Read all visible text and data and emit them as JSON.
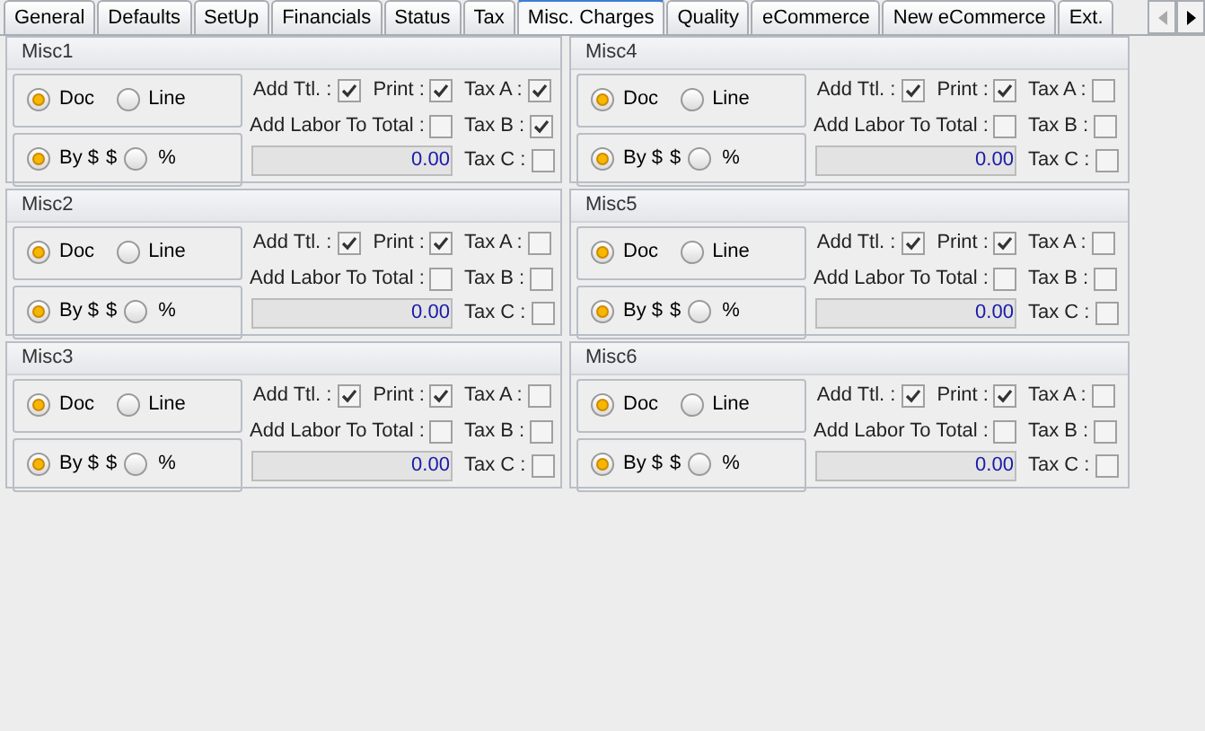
{
  "tabs": [
    {
      "label": "General",
      "selected": false
    },
    {
      "label": "Defaults",
      "selected": false
    },
    {
      "label": "SetUp",
      "selected": false
    },
    {
      "label": "Financials",
      "selected": false
    },
    {
      "label": "Status",
      "selected": false
    },
    {
      "label": "Tax",
      "selected": false
    },
    {
      "label": "Misc. Charges",
      "selected": true
    },
    {
      "label": "Quality",
      "selected": false
    },
    {
      "label": "eCommerce",
      "selected": false
    },
    {
      "label": "New eCommerce",
      "selected": false
    },
    {
      "label": "Ext.",
      "selected": false
    }
  ],
  "panels": [
    {
      "title": "Misc1",
      "scope": [
        {
          "label": "Doc",
          "selected": true
        },
        {
          "label": "Line",
          "selected": false
        }
      ],
      "by_label": "By $",
      "by_selected": true,
      "currency": "$",
      "pct_label": "%",
      "pct_selected": false,
      "add_ttl": {
        "label": "Add Ttl. :",
        "checked": true
      },
      "print": {
        "label": "Print :",
        "checked": true
      },
      "add_labor": {
        "label": "Add Labor To Total :",
        "checked": false
      },
      "amount": "0.00",
      "taxes": [
        {
          "label": "Tax A :",
          "checked": true
        },
        {
          "label": "Tax B :",
          "checked": true
        },
        {
          "label": "Tax C :",
          "checked": false
        }
      ]
    },
    {
      "title": "Misc4",
      "scope": [
        {
          "label": "Doc",
          "selected": true
        },
        {
          "label": "Line",
          "selected": false
        }
      ],
      "by_label": "By $",
      "by_selected": true,
      "currency": "$",
      "pct_label": "%",
      "pct_selected": false,
      "add_ttl": {
        "label": "Add Ttl. :",
        "checked": true
      },
      "print": {
        "label": "Print :",
        "checked": true
      },
      "add_labor": {
        "label": "Add Labor To Total :",
        "checked": false
      },
      "amount": "0.00",
      "taxes": [
        {
          "label": "Tax A :",
          "checked": false
        },
        {
          "label": "Tax B :",
          "checked": false
        },
        {
          "label": "Tax C :",
          "checked": false
        }
      ]
    },
    {
      "title": "Misc2",
      "scope": [
        {
          "label": "Doc",
          "selected": true
        },
        {
          "label": "Line",
          "selected": false
        }
      ],
      "by_label": "By $",
      "by_selected": true,
      "currency": "$",
      "pct_label": "%",
      "pct_selected": false,
      "add_ttl": {
        "label": "Add Ttl. :",
        "checked": true
      },
      "print": {
        "label": "Print :",
        "checked": true
      },
      "add_labor": {
        "label": "Add Labor To Total :",
        "checked": false
      },
      "amount": "0.00",
      "taxes": [
        {
          "label": "Tax A :",
          "checked": false
        },
        {
          "label": "Tax B :",
          "checked": false
        },
        {
          "label": "Tax C :",
          "checked": false
        }
      ]
    },
    {
      "title": "Misc5",
      "scope": [
        {
          "label": "Doc",
          "selected": true
        },
        {
          "label": "Line",
          "selected": false
        }
      ],
      "by_label": "By $",
      "by_selected": true,
      "currency": "$",
      "pct_label": "%",
      "pct_selected": false,
      "add_ttl": {
        "label": "Add Ttl. :",
        "checked": true
      },
      "print": {
        "label": "Print :",
        "checked": true
      },
      "add_labor": {
        "label": "Add Labor To Total :",
        "checked": false
      },
      "amount": "0.00",
      "taxes": [
        {
          "label": "Tax A :",
          "checked": false
        },
        {
          "label": "Tax B :",
          "checked": false
        },
        {
          "label": "Tax C :",
          "checked": false
        }
      ]
    },
    {
      "title": "Misc3",
      "scope": [
        {
          "label": "Doc",
          "selected": true
        },
        {
          "label": "Line",
          "selected": false
        }
      ],
      "by_label": "By $",
      "by_selected": true,
      "currency": "$",
      "pct_label": "%",
      "pct_selected": false,
      "add_ttl": {
        "label": "Add Ttl. :",
        "checked": true
      },
      "print": {
        "label": "Print :",
        "checked": true
      },
      "add_labor": {
        "label": "Add Labor To Total :",
        "checked": false
      },
      "amount": "0.00",
      "taxes": [
        {
          "label": "Tax A :",
          "checked": false
        },
        {
          "label": "Tax B :",
          "checked": false
        },
        {
          "label": "Tax C :",
          "checked": false
        }
      ]
    },
    {
      "title": "Misc6",
      "scope": [
        {
          "label": "Doc",
          "selected": true
        },
        {
          "label": "Line",
          "selected": false
        }
      ],
      "by_label": "By $",
      "by_selected": true,
      "currency": "$",
      "pct_label": "%",
      "pct_selected": false,
      "add_ttl": {
        "label": "Add Ttl. :",
        "checked": true
      },
      "print": {
        "label": "Print :",
        "checked": true
      },
      "add_labor": {
        "label": "Add Labor To Total :",
        "checked": false
      },
      "amount": "0.00",
      "taxes": [
        {
          "label": "Tax A :",
          "checked": false
        },
        {
          "label": "Tax B :",
          "checked": false
        },
        {
          "label": "Tax C :",
          "checked": false
        }
      ]
    }
  ]
}
